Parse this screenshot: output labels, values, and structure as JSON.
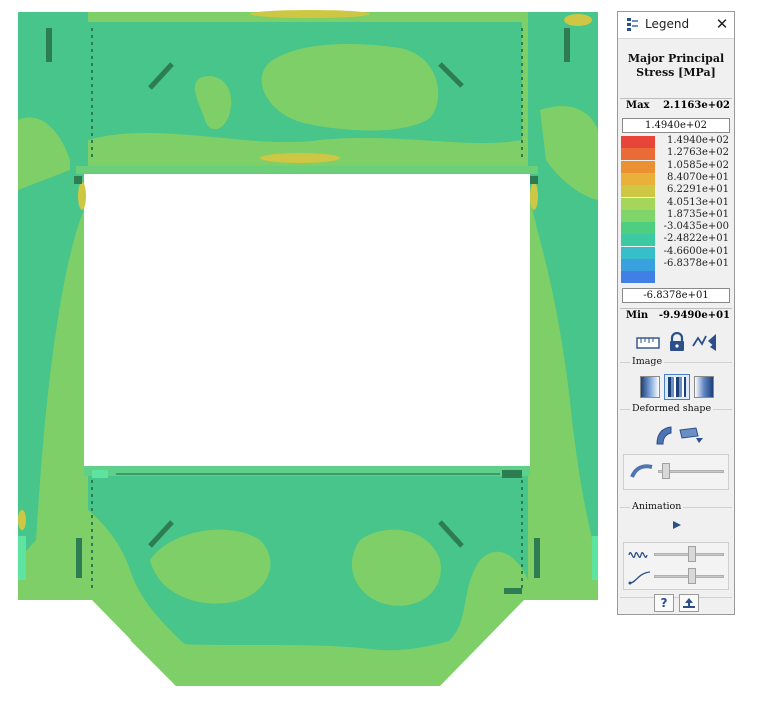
{
  "legend": {
    "window_title": "Legend",
    "close_glyph": "✕",
    "result_title_line1": "Major Principal",
    "result_title_line2": "Stress [MPa]",
    "max_label": "Max",
    "max_value": "2.1163e+02",
    "upper_limit": "1.4940e+02",
    "scale": [
      {
        "value": "1.4940e+02",
        "color": "#e8453a"
      },
      {
        "value": "1.2763e+02",
        "color": "#ea6b35"
      },
      {
        "value": "1.0585e+02",
        "color": "#ec9034"
      },
      {
        "value": "8.4070e+01",
        "color": "#e9b03a"
      },
      {
        "value": "6.2291e+01",
        "color": "#cdc744"
      },
      {
        "value": "4.0513e+01",
        "color": "#a5d65b"
      },
      {
        "value": "1.8735e+01",
        "color": "#7fd46a"
      },
      {
        "value": "-3.0435e+00",
        "color": "#4ece7f"
      },
      {
        "value": "-2.4822e+01",
        "color": "#3ccaa3"
      },
      {
        "value": "-4.6600e+01",
        "color": "#36bfc9"
      },
      {
        "value": "-6.8378e+01",
        "color": "#3aa1e0"
      },
      {
        "value": "",
        "color": "#3f7fe6"
      }
    ],
    "lower_limit": "-6.8378e+01",
    "min_label": "Min",
    "min_value": "-9.9490e+01",
    "image_section": "Image",
    "deformed_section": "Deformed shape",
    "animation_section": "Animation",
    "help_glyph": "?",
    "icons": [
      "ruler-icon",
      "lock-icon",
      "probe-icon",
      "smooth-image-icon",
      "banded-image-icon",
      "gradient-image-icon",
      "deform-icon",
      "deform-scale-icon",
      "play-icon",
      "amplitude-icon",
      "speed-icon",
      "help-icon",
      "export-icon"
    ]
  },
  "colors": {
    "model_green": "#7fcf68",
    "model_teal": "#47c58a",
    "accent_blue": "#2a4f8a"
  }
}
